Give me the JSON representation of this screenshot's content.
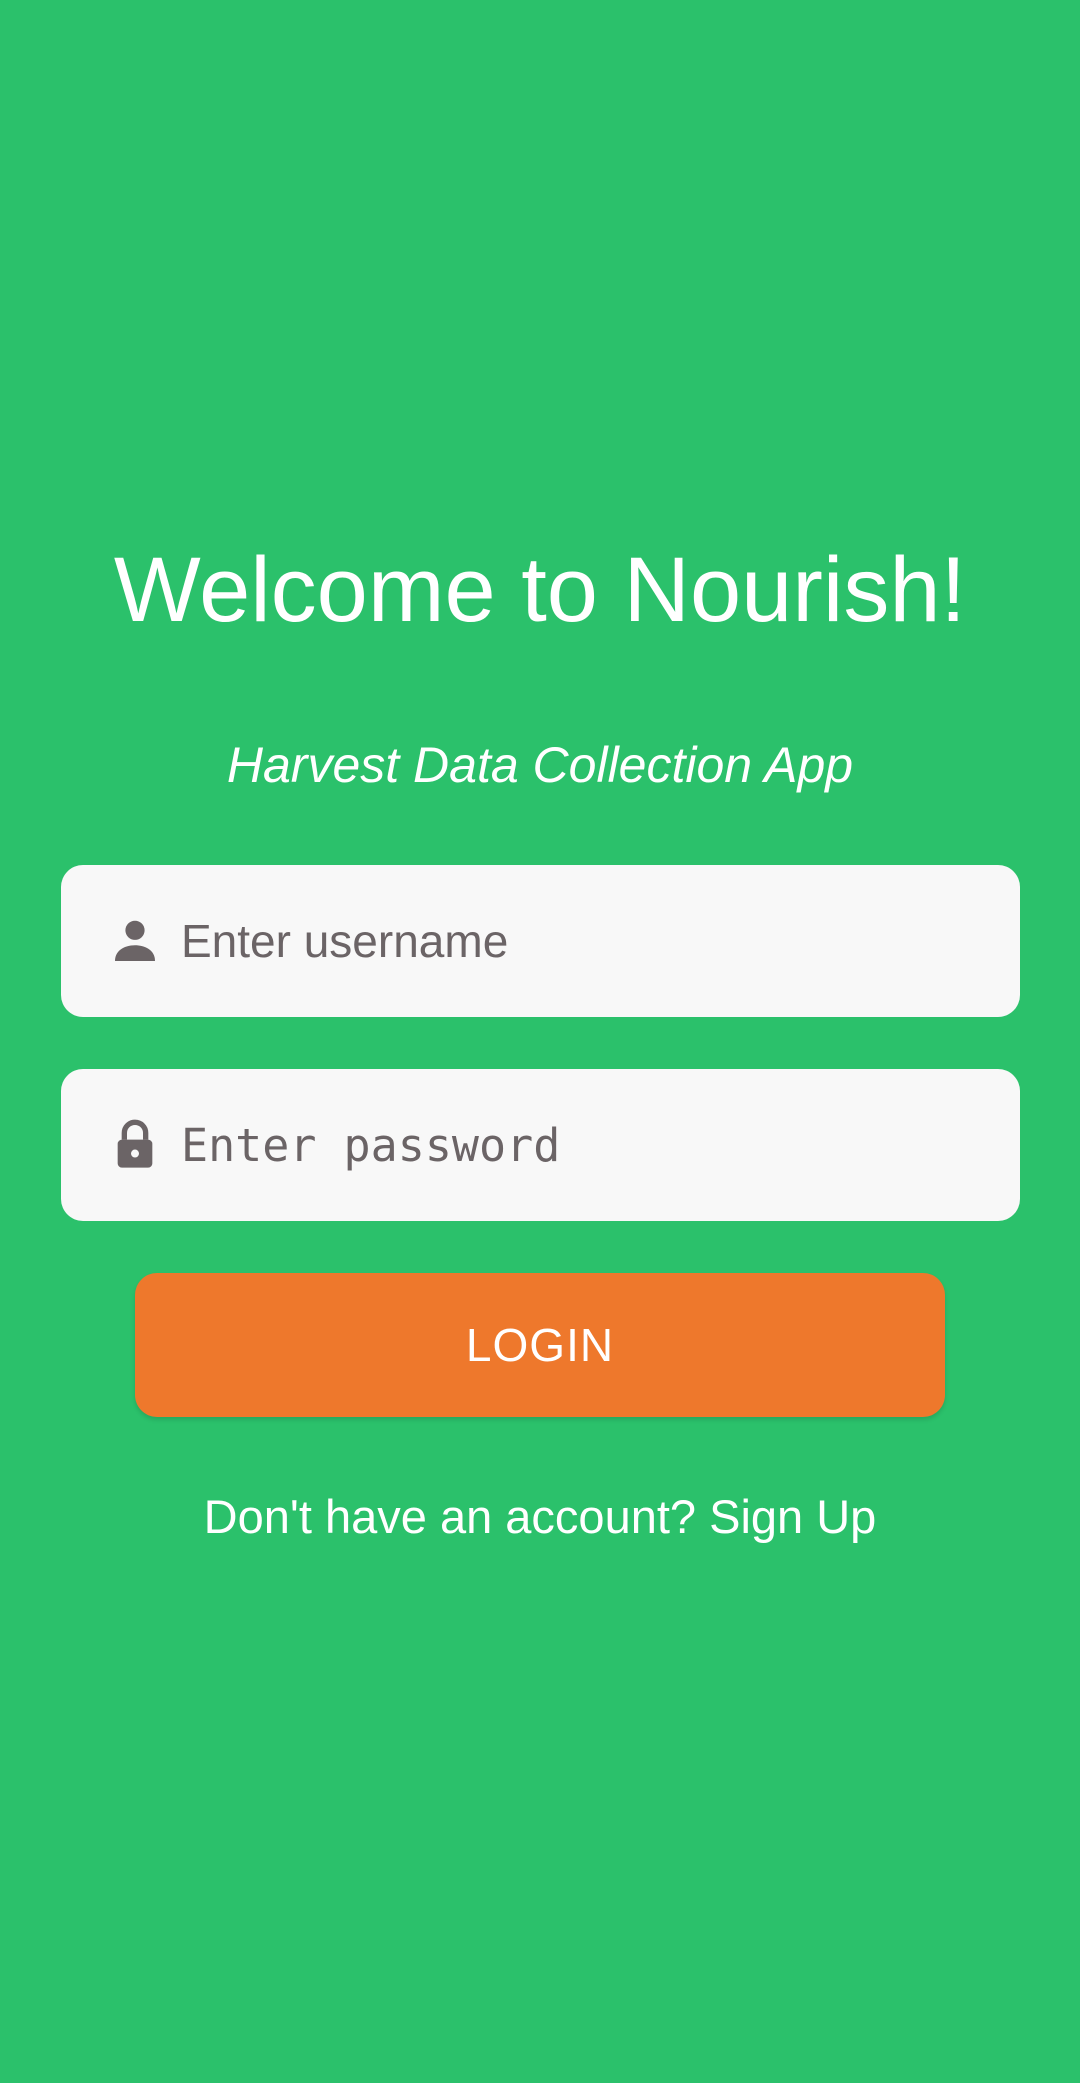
{
  "header": {
    "title": "Welcome to Nourish!",
    "subtitle": "Harvest Data Collection App"
  },
  "form": {
    "username": {
      "placeholder": "Enter username",
      "value": "",
      "icon": "person-icon"
    },
    "password": {
      "placeholder": "Enter password",
      "value": "",
      "icon": "lock-icon"
    },
    "login_label": "LOGIN",
    "signup_text": "Don't have an account? Sign Up"
  },
  "colors": {
    "background": "#2bc16b",
    "button": "#ee782c",
    "field_background": "#f8f8f8",
    "placeholder_text": "#6b6466",
    "text": "#ffffff"
  }
}
